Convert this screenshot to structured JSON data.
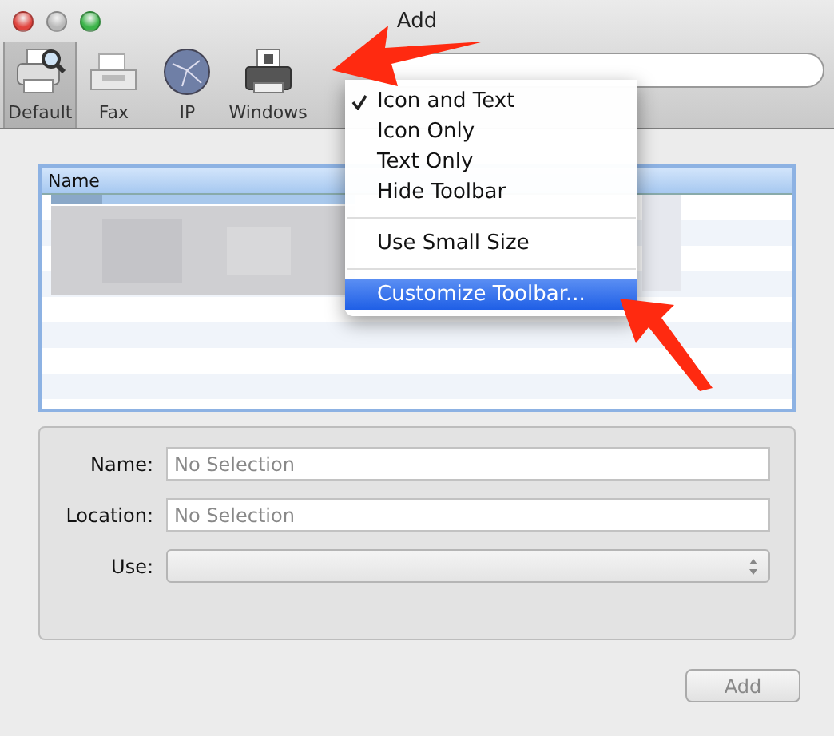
{
  "window": {
    "title": "Add"
  },
  "toolbar": {
    "items": [
      {
        "label": "Default",
        "kind": "printer",
        "selected": true
      },
      {
        "label": "Fax",
        "kind": "fax",
        "selected": false
      },
      {
        "label": "IP",
        "kind": "globe",
        "selected": false
      },
      {
        "label": "Windows",
        "kind": "windows",
        "selected": false
      }
    ]
  },
  "list": {
    "columns": [
      "Name"
    ]
  },
  "context_menu": {
    "items": [
      {
        "kind": "item",
        "label": "Icon and Text",
        "checked": true,
        "highlighted": false
      },
      {
        "kind": "item",
        "label": "Icon Only",
        "checked": false,
        "highlighted": false
      },
      {
        "kind": "item",
        "label": "Text Only",
        "checked": false,
        "highlighted": false
      },
      {
        "kind": "item",
        "label": "Hide Toolbar",
        "checked": false,
        "highlighted": false
      },
      {
        "kind": "separator"
      },
      {
        "kind": "item",
        "label": "Use Small Size",
        "checked": false,
        "highlighted": false
      },
      {
        "kind": "separator"
      },
      {
        "kind": "item",
        "label": "Customize Toolbar...",
        "checked": false,
        "highlighted": true
      }
    ]
  },
  "form": {
    "fields": [
      {
        "kind": "text",
        "label": "Name:",
        "placeholder": "No Selection"
      },
      {
        "kind": "text",
        "label": "Location:",
        "placeholder": "No Selection"
      },
      {
        "kind": "popup",
        "label": "Use:"
      }
    ]
  },
  "button": {
    "label": "Add",
    "disabled": true
  }
}
